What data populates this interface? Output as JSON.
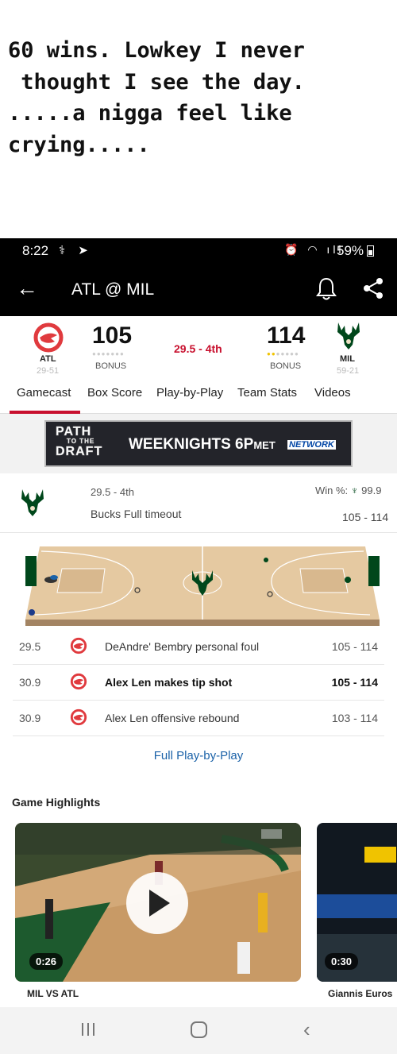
{
  "caption": "60 wins. Lowkey I never\n thought I see the day.\n.....a nigga feel like\ncrying.....",
  "status_bar": {
    "time": "8:22",
    "battery": "59%"
  },
  "app_bar": {
    "title": "ATL @ MIL"
  },
  "scoreboard": {
    "away": {
      "abbr": "ATL",
      "record": "29-51",
      "score": "105",
      "bonus": "BONUS"
    },
    "home": {
      "abbr": "MIL",
      "record": "59-21",
      "score": "114",
      "bonus": "BONUS"
    },
    "clock": "29.5 - 4th"
  },
  "tabs": [
    "Gamecast",
    "Box Score",
    "Play-by-Play",
    "Team Stats",
    "Videos"
  ],
  "banner": {
    "line1": "PATH",
    "line2": "TO THE",
    "line3": "DRAFT",
    "text_main": "WEEKNIGHTS 6P",
    "text_small": "M",
    "text_tz": "ET",
    "network": "NETWORK"
  },
  "update": {
    "period": "29.5 - 4th",
    "event": "Bucks Full timeout",
    "win_label": "Win %:",
    "win_value": "99.9",
    "score": "105 - 114"
  },
  "plays": [
    {
      "time": "29.5",
      "desc": "DeAndre' Bembry personal foul",
      "score": "105 - 114",
      "bold": false
    },
    {
      "time": "30.9",
      "desc": "Alex Len makes tip shot",
      "score": "105 - 114",
      "bold": true
    },
    {
      "time": "30.9",
      "desc": "Alex Len offensive rebound",
      "score": "103 - 114",
      "bold": false
    }
  ],
  "full_pbp": "Full Play-by-Play",
  "highlights": {
    "title": "Game Highlights",
    "videos": [
      {
        "duration": "0:26",
        "caption": "MIL VS ATL"
      },
      {
        "duration": "0:30",
        "caption": "Giannis Euros"
      }
    ]
  },
  "colors": {
    "espn_red": "#c8102e",
    "hawks_red": "#e03a3e",
    "bucks_green": "#00471b",
    "link_blue": "#1b62a8"
  }
}
